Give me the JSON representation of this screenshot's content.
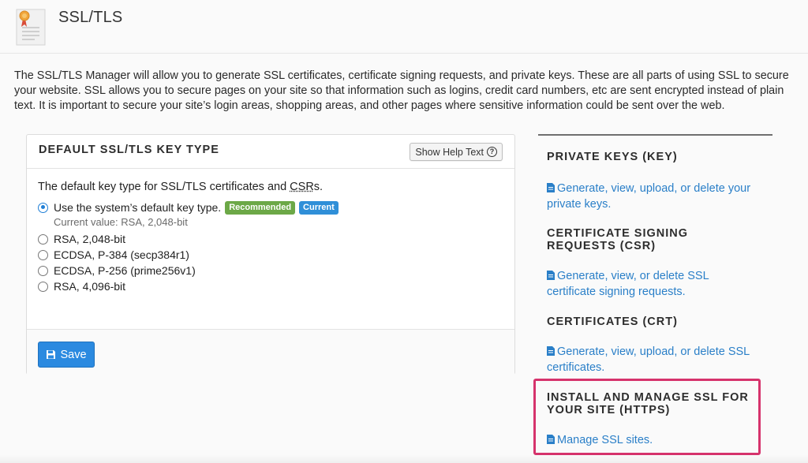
{
  "header": {
    "title": "SSL/TLS"
  },
  "intro": "The SSL/TLS Manager will allow you to generate SSL certificates, certificate signing requests, and private keys. These are all parts of using SSL to secure your website. SSL allows you to secure pages on your site so that information such as logins, credit card numbers, etc are sent encrypted instead of plain text. It is important to secure your site’s login areas, shopping areas, and other pages where sensitive information could be sent over the web.",
  "panel": {
    "title": "DEFAULT SSL/TLS KEY TYPE",
    "help_label": "Show Help Text",
    "desc_prefix": "The default key type for SSL/TLS certificates and ",
    "desc_abbr": "CSR",
    "desc_suffix": "s.",
    "options": [
      {
        "label": "Use the system’s default key type.",
        "checked": true
      },
      {
        "label": "RSA, 2,048-bit",
        "checked": false
      },
      {
        "label": "ECDSA, P-384 (secp384r1)",
        "checked": false
      },
      {
        "label": "ECDSA, P-256 (prime256v1)",
        "checked": false
      },
      {
        "label": "RSA, 4,096-bit",
        "checked": false
      }
    ],
    "badge_recommended": "Recommended",
    "badge_current": "Current",
    "current_value": "Current value: RSA, 2,048-bit",
    "save_label": "Save"
  },
  "sidebar": {
    "sections": [
      {
        "heading": "PRIVATE KEYS (KEY)",
        "link": "Generate, view, upload, or delete your private keys."
      },
      {
        "heading": "CERTIFICATE SIGNING REQUESTS (CSR)",
        "link": "Generate, view, or delete SSL certificate signing requests."
      },
      {
        "heading": "CERTIFICATES (CRT)",
        "link": "Generate, view, upload, or delete SSL certificates."
      },
      {
        "heading": "INSTALL AND MANAGE SSL FOR YOUR SITE (HTTPS)",
        "link": "Manage SSL sites."
      }
    ]
  },
  "colors": {
    "accent": "#2b8ae0",
    "link": "#2a7fc8",
    "highlight": "#d6336c",
    "recommended": "#6ca847",
    "current": "#2f8fd8"
  },
  "icons": [
    "certificate-icon",
    "help-icon",
    "save-icon",
    "document-icon"
  ]
}
